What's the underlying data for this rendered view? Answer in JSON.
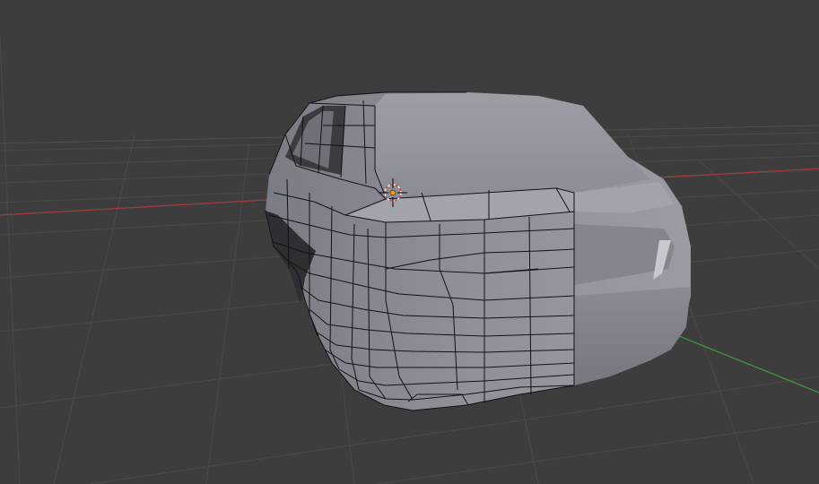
{
  "viewport": {
    "background_color": "#3d3d3d",
    "grid_color": "#4a4a4a",
    "x_axis_color": "#a83a3a",
    "y_axis_color": "#3f9a3f",
    "mesh_color": "#8d8d96",
    "wire_color": "#111216"
  },
  "scene": {
    "object": "car-rear-mesh",
    "mode": "edit-mode-partial-wireframe",
    "cursor": "3d-cursor-icon"
  }
}
